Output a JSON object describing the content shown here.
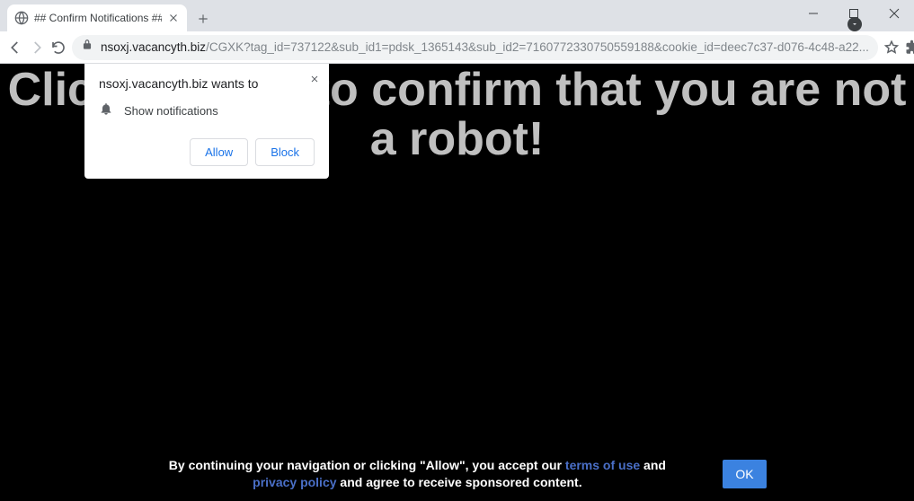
{
  "tab": {
    "title": "## Confirm Notifications ##"
  },
  "url": {
    "domain": "nsoxj.vacancyth.biz",
    "path": "/CGXK?tag_id=737122&sub_id1=pdsk_1365143&sub_id2=7160772330750559188&cookie_id=deec7c37-d076-4c48-a22..."
  },
  "prompt": {
    "title": "nsoxj.vacancyth.biz wants to",
    "message": "Show notifications",
    "allow": "Allow",
    "block": "Block"
  },
  "headline": "Click \"Allow\" to confirm that you are not a robot!",
  "consent": {
    "pre": "By continuing your navigation or clicking \"Allow\", you accept our ",
    "terms": "terms of use",
    "and": " and ",
    "privacy": "privacy policy",
    "post": " and agree to receive sponsored content."
  },
  "ok": "OK"
}
